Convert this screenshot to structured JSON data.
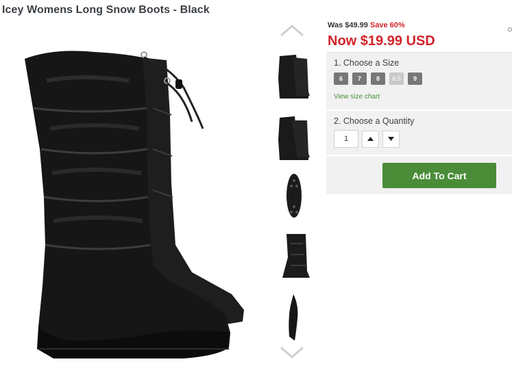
{
  "product": {
    "title": "Icey Womens Long Snow Boots - Black"
  },
  "pricing": {
    "was_label": "Was $49.99",
    "save_text": "Save 60%",
    "now_text": "Now $19.99 USD"
  },
  "size_section": {
    "label": "1. Choose a Size",
    "sizes": [
      "6",
      "7",
      "8",
      "8.5",
      "9"
    ],
    "disabled_size": "8.5",
    "chart_link": "View size chart"
  },
  "quantity_section": {
    "label": "2. Choose a Quantity",
    "value": "1"
  },
  "cart": {
    "button_label": "Add To Cart"
  },
  "colors": {
    "price_red": "#d2232a",
    "cart_green": "#4a8c38",
    "link_green": "#4a8c3a",
    "panel_gray": "#f1f1f1"
  },
  "icons": {
    "thumb_up": "chevron-up-icon",
    "thumb_down": "chevron-down-icon",
    "qty_up": "triangle-up-icon",
    "qty_down": "triangle-down-icon"
  }
}
